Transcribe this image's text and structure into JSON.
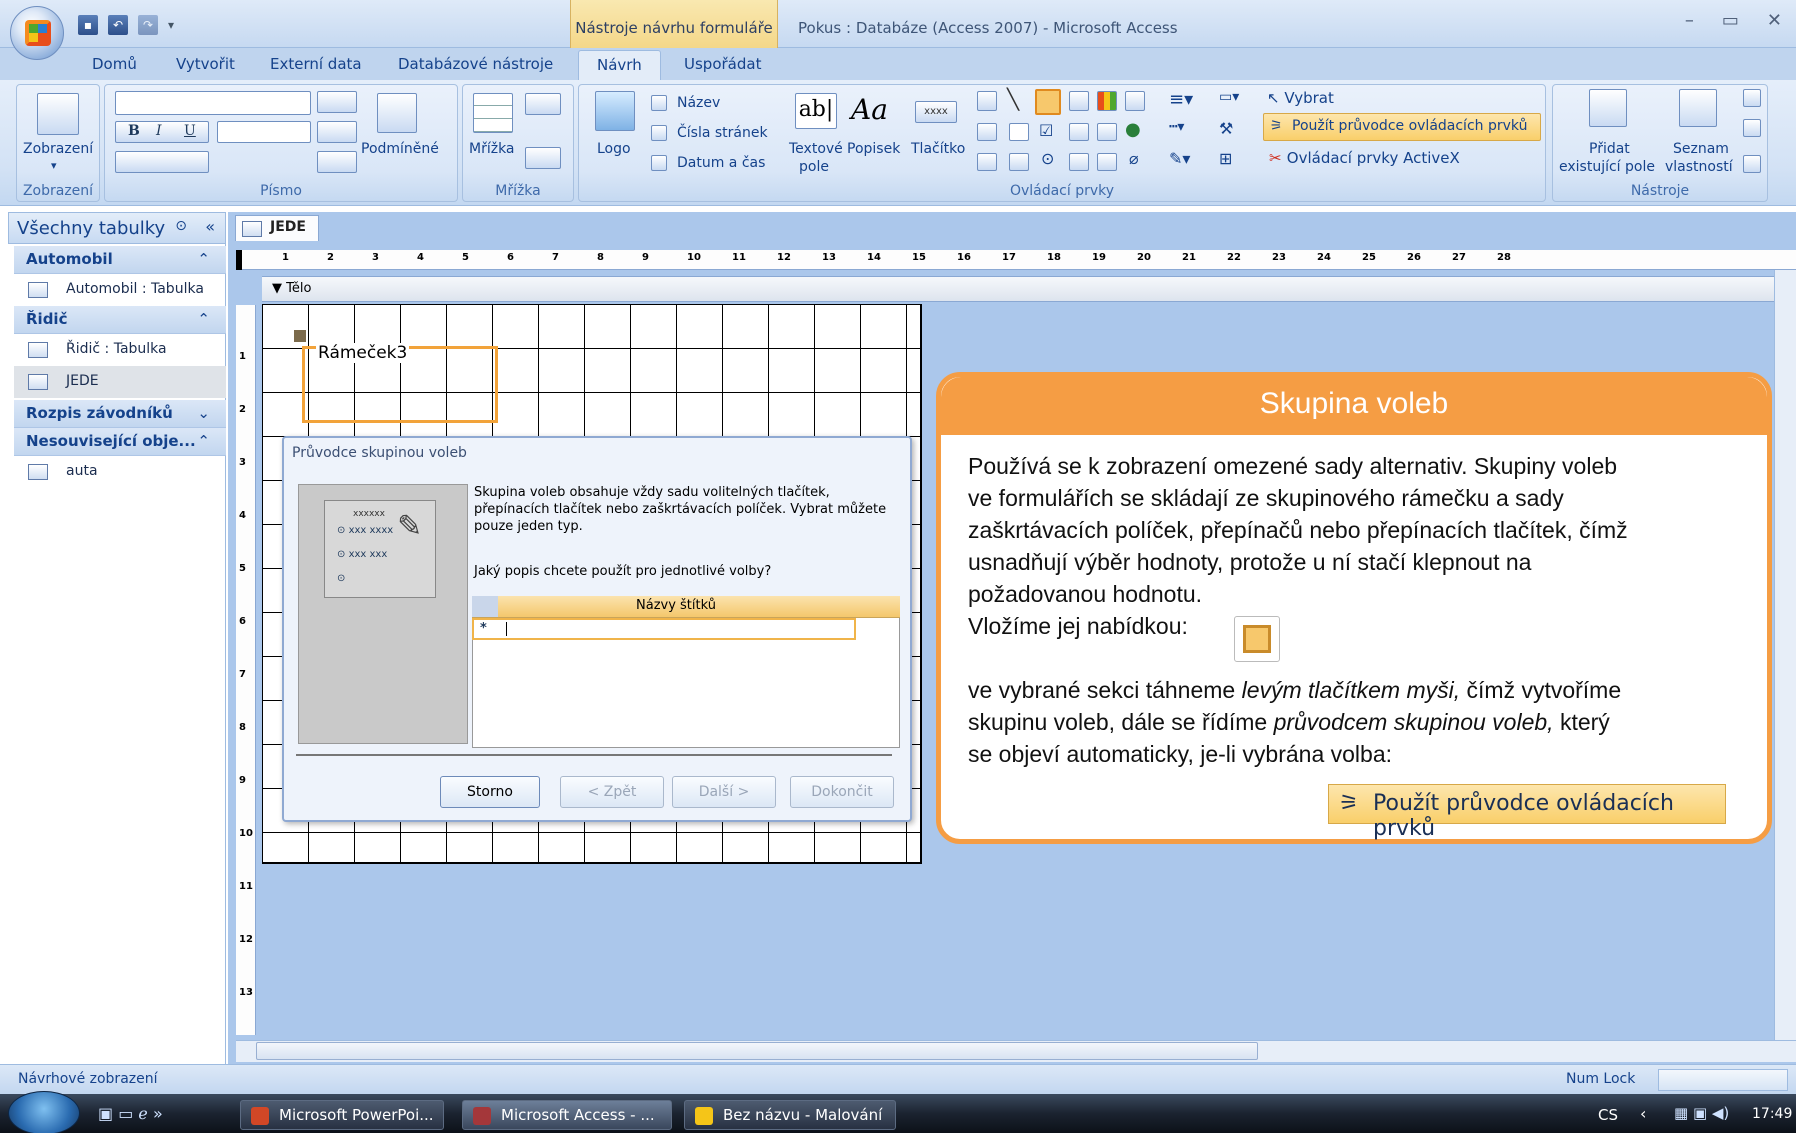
{
  "window": {
    "title": "Pokus : Databáze (Access 2007) - Microsoft Access",
    "contextual_tool": "Nástroje návrhu formuláře",
    "controls": [
      "–",
      "▭",
      "✕"
    ]
  },
  "tabs": [
    {
      "label": "Domů",
      "active": false
    },
    {
      "label": "Vytvořit",
      "active": false
    },
    {
      "label": "Externí data",
      "active": false
    },
    {
      "label": "Databázové nástroje",
      "active": false
    },
    {
      "label": "Návrh",
      "active": true
    },
    {
      "label": "Uspořádat",
      "active": false
    }
  ],
  "ribbon": {
    "groups": {
      "zobrazeni": "Zobrazení",
      "pismo": "Písmo",
      "mrizka": "Mřížka",
      "ovladaci_prvky": "Ovládací prvky",
      "nastroje": "Nástroje"
    },
    "view_button": "Zobrazení",
    "bold": "B",
    "italic": "I",
    "underline": "U",
    "conditional": "Podmíněné",
    "grid_button": "Mřížka",
    "logo": "Logo",
    "title_btn": "Název",
    "page_numbers": "Čísla stránek",
    "date_time": "Datum a čas",
    "textbox_l1": "Textové",
    "textbox_l2": "pole",
    "textbox_glyph": "ab|",
    "label_btn": "Popisek",
    "label_glyph": "Aa",
    "button_btn": "Tlačítko",
    "button_glyph": "xxxx",
    "select": "Vybrat",
    "use_wizards": "Použít průvodce ovládacích prvků",
    "activex": "Ovládací prvky ActiveX",
    "add_existing_l1": "Přidat",
    "add_existing_l2": "existující pole",
    "property_sheet_l1": "Seznam",
    "property_sheet_l2": "vlastností"
  },
  "nav": {
    "header": "Všechny tabulky",
    "categories": [
      {
        "label": "Automobil",
        "items": [
          "Automobil : Tabulka"
        ]
      },
      {
        "label": "Řidič",
        "items": [
          "Řidič : Tabulka",
          "JEDE"
        ]
      },
      {
        "label": "Rozpis závodníků",
        "items": []
      },
      {
        "label": "Nesouvisející obje...",
        "items": [
          "auta"
        ]
      }
    ]
  },
  "document": {
    "tab": "JEDE",
    "section": "Tělo",
    "frame_label": "Rámeček3",
    "ruler_numbers": [
      "1",
      "2",
      "3",
      "4",
      "5",
      "6",
      "7",
      "8",
      "9",
      "10",
      "11",
      "12",
      "13",
      "14",
      "15",
      "16",
      "17",
      "18",
      "19",
      "20",
      "21",
      "22",
      "23",
      "24",
      "25",
      "26",
      "27",
      "28"
    ],
    "vruler_numbers": [
      "1",
      "2",
      "3",
      "4",
      "5",
      "6",
      "7",
      "8",
      "9",
      "10",
      "11",
      "12",
      "13"
    ]
  },
  "wizard": {
    "title": "Průvodce skupinou voleb",
    "description": "Skupina voleb obsahuje vždy sadu volitelných tlačítek, přepínacích tlačítek nebo zaškrtávacích políček. Vybrat můžete pouze jeden typ.",
    "question": "Jaký popis chcete použít pro jednotlivé volby?",
    "column_header": "Názvy štítků",
    "row_marker": "*",
    "sample_header": "xxxxxx",
    "sample_options": [
      "xxx xxxx",
      "xxx xxx"
    ],
    "buttons": {
      "cancel": "Storno",
      "back": "< Zpět",
      "next": "Další >",
      "finish": "Dokončit"
    }
  },
  "callout": {
    "title": "Skupina voleb",
    "paragraph1": [
      "Používá se k zobrazení omezené sady alternativ. Skupiny voleb",
      "ve formulářích se skládají ze skupinového rámečku a sady",
      "zaškrtávacích políček, přepínačů nebo přepínacích tlačítek, čímž",
      "usnadňují výběr hodnoty, protože u ní stačí klepnout na",
      "požadovanou hodnotu."
    ],
    "insert_via": "Vložíme jej nabídkou:",
    "p2_line1_a": "ve vybrané sekci táhneme ",
    "p2_line1_em": "levým tlačítkem myši,",
    "p2_line1_b": " čímž vytvoříme",
    "p2_line2_a": "skupinu voleb, dále se řídíme ",
    "p2_line2_em": "průvodcem skupinou voleb,",
    "p2_line2_b": " který",
    "p2_line3": "se objeví automaticky, je-li vybrána volba:",
    "wizard_button": "Použít průvodce ovládacích prvků"
  },
  "status": {
    "left": "Návrhové zobrazení",
    "numlock": "Num Lock"
  },
  "taskbar": {
    "tasks": [
      "Microsoft PowerPoi...",
      "Microsoft Access - ...",
      "Bez názvu - Malování"
    ],
    "lang": "CS",
    "time": "17:49"
  },
  "colors": {
    "accent_orange": "#f59d44",
    "ribbon_blue": "#d3e2f5",
    "text_blue": "#15428b"
  }
}
